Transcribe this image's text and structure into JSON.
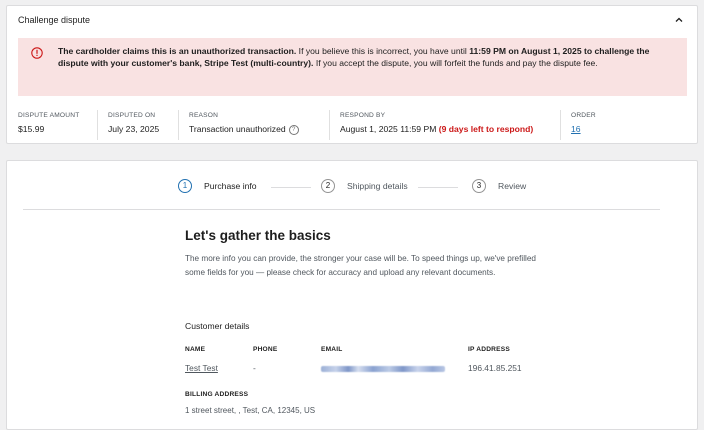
{
  "dispute_card": {
    "title": "Challenge dispute",
    "notice": {
      "bold_1": "The cardholder claims this is an unauthorized transaction.",
      "text_1": " If you believe this is incorrect, you have until ",
      "bold_2": "11:59 PM on August 1, 2025 to challenge the dispute with your customer's bank, Stripe Test (multi-country).",
      "text_2": " If you accept the dispute, you will forfeit the funds and pay the dispute fee."
    },
    "summary": {
      "amount_label": "Dispute amount",
      "amount_value": "$15.99",
      "disputed_label": "Disputed on",
      "disputed_value": "July 23, 2025",
      "reason_label": "Reason",
      "reason_value": "Transaction unauthorized",
      "respond_label": "Respond by",
      "respond_value": "August 1, 2025 11:59 PM",
      "respond_note": "(9 days left to respond)",
      "order_label": "Order",
      "order_value": "16"
    }
  },
  "stepper": {
    "steps": [
      {
        "num": "1",
        "label": "Purchase info"
      },
      {
        "num": "2",
        "label": "Shipping details"
      },
      {
        "num": "3",
        "label": "Review"
      }
    ]
  },
  "purchase": {
    "heading": "Let's gather the basics",
    "intro": "The more info you can provide, the stronger your case will be. To speed things up, we've prefilled some fields for you — please check for accuracy and upload any relevant documents.",
    "customer_title": "Customer details",
    "name_label": "Name",
    "name_value": "Test Test",
    "phone_label": "Phone",
    "phone_value": "-",
    "email_label": "Email",
    "ip_label": "IP address",
    "ip_value": "196.41.85.251",
    "billing_label": "Billing address",
    "billing_value": "1 street street, , Test, CA, 12345, US"
  },
  "colors": {
    "accent": "#2271b1",
    "notice_bg": "#f9e2e2",
    "danger": "#cc1818"
  }
}
